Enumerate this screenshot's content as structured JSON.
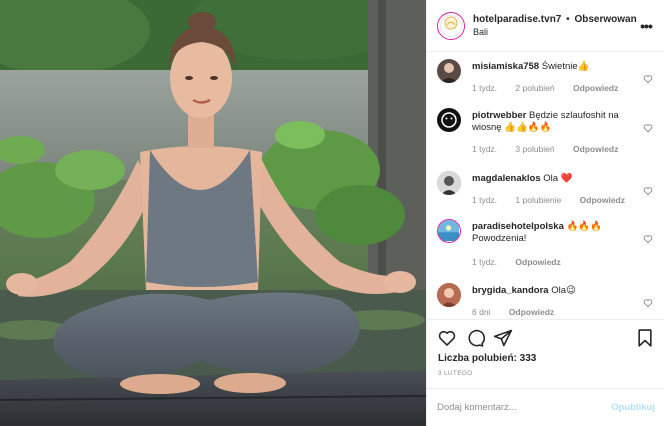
{
  "post": {
    "username": "hotelparadise.tvn7",
    "separator": "•",
    "follow_label": "Obserwowanie",
    "location": "Bali",
    "more_icon": "more-horizontal-icon",
    "avatar_icon": "hotel-logo-icon"
  },
  "comments": [
    {
      "username": "misiamiska758",
      "text": "Świetnie👍",
      "time": "1 tydz.",
      "likes": "2 polubień",
      "reply": "Odpowiedz",
      "avatar_color": "#5a4a45"
    },
    {
      "username": "piotrwebber",
      "text": "Będzie szlaufoshit na wiosnę 👍👍🔥🔥",
      "time": "1 tydz.",
      "likes": "3 polubień",
      "reply": "Odpowiedz",
      "avatar_color": "#111111"
    },
    {
      "username": "magdalenaklos",
      "text": "Ola ❤️",
      "time": "1 tydz.",
      "likes": "1 polubienie",
      "reply": "Odpowiedz",
      "avatar_color": "#8c8c8c"
    },
    {
      "username": "paradisehotelpolska",
      "text": "🔥🔥🔥",
      "text2": "Powodzenia!",
      "time": "1 tydz.",
      "likes": "",
      "reply": "Odpowiedz",
      "avatar_color": "#3a8fc7"
    },
    {
      "username": "brygida_kandora",
      "text": "Ola😉",
      "time": "6 dni",
      "likes": "",
      "reply": "Odpowiedz",
      "avatar_color": "#c98a6d"
    }
  ],
  "actions": {
    "like_icon": "heart-icon",
    "comment_icon": "comment-icon",
    "share_icon": "share-icon",
    "save_icon": "bookmark-icon",
    "likes_text": "Liczba polubień: 333",
    "date_text": "3 LUTEGO"
  },
  "add_comment": {
    "placeholder": "Dodaj komentarz...",
    "publish_label": "Opublikuj"
  },
  "colors": {
    "accent": "#0095f6",
    "publish_disabled": "#b2dffc",
    "meta_gray": "#8e8e8e",
    "border": "#efefef",
    "story_ring": "#d6249f"
  }
}
